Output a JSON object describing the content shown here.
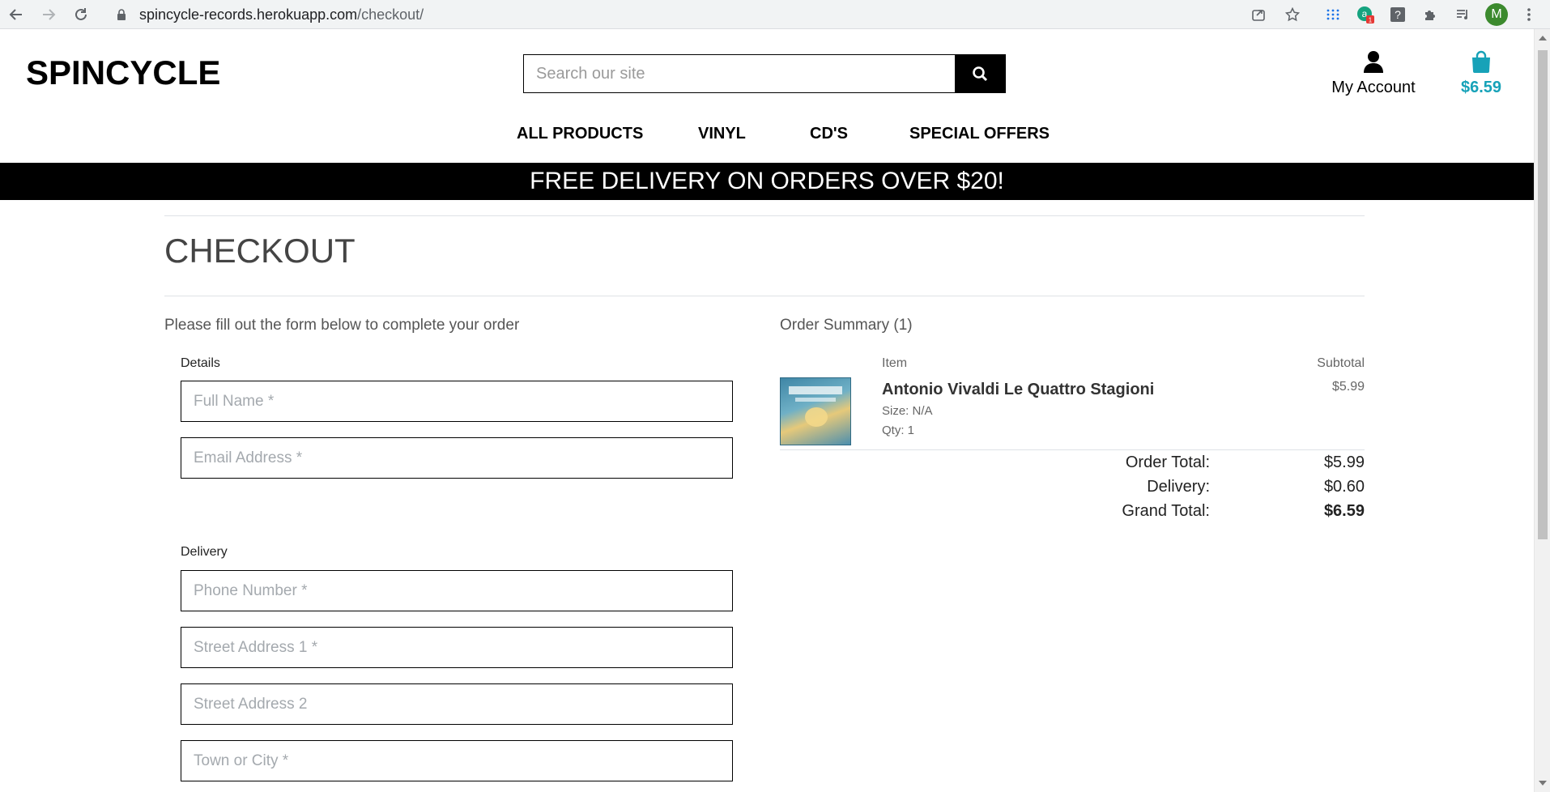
{
  "browser": {
    "url_host": "spincycle-records.herokuapp.com",
    "url_path": "/checkout/",
    "profile_initial": "M",
    "extension_badge": "1"
  },
  "header": {
    "logo": "SPINCYCLE",
    "search_placeholder": "Search our site",
    "account_label": "My Account",
    "bag_total": "$6.59",
    "accent_color": "#17a2b8"
  },
  "nav": {
    "items": [
      "ALL PRODUCTS",
      "VINYL",
      "CD'S",
      "SPECIAL OFFERS"
    ]
  },
  "banner": "FREE DELIVERY ON ORDERS OVER $20!",
  "checkout": {
    "title": "CHECKOUT",
    "intro": "Please fill out the form below to complete your order",
    "details_legend": "Details",
    "delivery_legend": "Delivery",
    "fields": {
      "full_name": "Full Name *",
      "email": "Email Address *",
      "phone": "Phone Number *",
      "street1": "Street Address 1 *",
      "street2": "Street Address 2",
      "town": "Town or City *"
    }
  },
  "summary": {
    "title": "Order Summary (1)",
    "col_item": "Item",
    "col_subtotal": "Subtotal",
    "item": {
      "name": "Antonio Vivaldi Le Quattro Stagioni",
      "size": "Size: N/A",
      "qty": "Qty: 1",
      "price": "$5.99"
    },
    "order_total_label": "Order Total:",
    "order_total": "$5.99",
    "delivery_label": "Delivery:",
    "delivery": "$0.60",
    "grand_total_label": "Grand Total:",
    "grand_total": "$6.59"
  }
}
